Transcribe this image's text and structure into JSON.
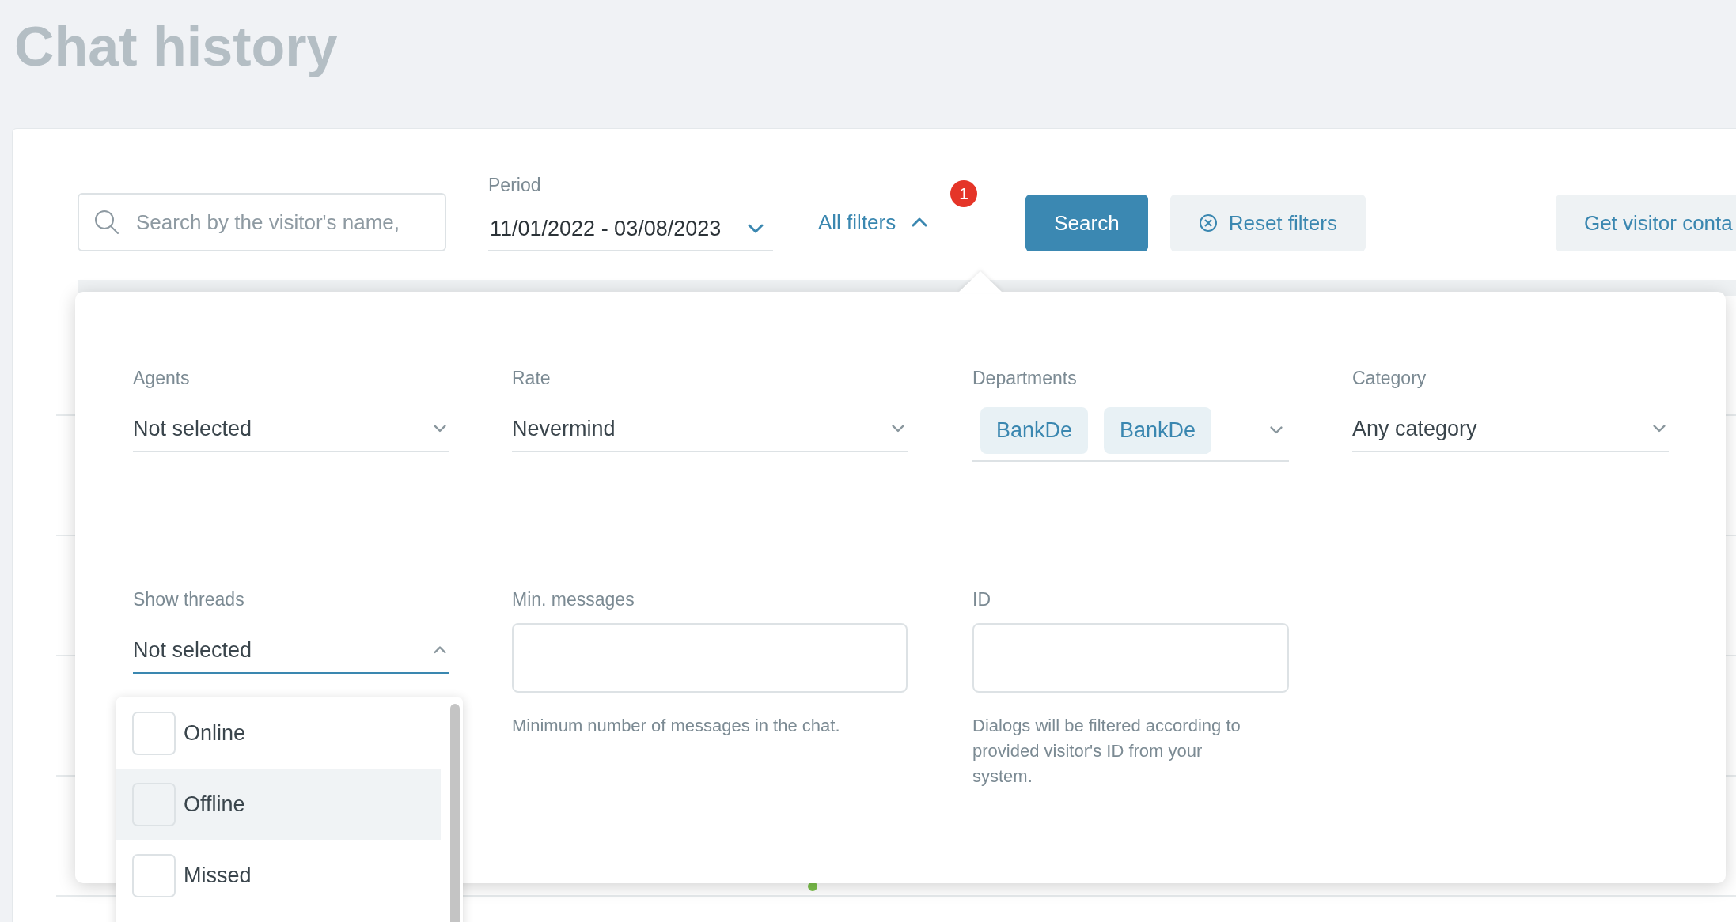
{
  "page_title": "Chat history",
  "toolbar": {
    "search": {
      "placeholder": "Search by the visitor's name,"
    },
    "period": {
      "label": "Period",
      "value": "11/01/2022 - 03/08/2023"
    },
    "all_filters": {
      "label": "All filters",
      "expanded": true,
      "badge": "1"
    },
    "buttons": [
      {
        "label": "Search",
        "kind": "primary"
      },
      {
        "label": "Reset filters",
        "kind": "reset"
      },
      {
        "label": "Get visitor conta",
        "kind": "secondary"
      }
    ]
  },
  "filters": [
    {
      "kind": "select",
      "label": "Agents",
      "value": "Not selected",
      "expanded": false
    },
    {
      "kind": "select",
      "label": "Rate",
      "value": "Nevermind",
      "expanded": false
    },
    {
      "kind": "tags",
      "label": "Departments",
      "tags": [
        "BankDe",
        "BankDe"
      ]
    },
    {
      "kind": "select",
      "label": "Category",
      "value": "Any category",
      "expanded": false
    },
    {
      "kind": "select",
      "label": "Show threads",
      "value": "Not selected",
      "expanded": true,
      "options": [
        {
          "label": "Online",
          "checked": false,
          "highlighted": false
        },
        {
          "label": "Offline",
          "checked": false,
          "highlighted": true
        },
        {
          "label": "Missed",
          "checked": false,
          "highlighted": false
        }
      ]
    },
    {
      "kind": "input",
      "label": "Min. messages",
      "help": "Minimum number of messages in the chat."
    },
    {
      "kind": "input",
      "label": "ID",
      "help": "Dialogs will be filtered according to provided visitor's ID from your system."
    }
  ]
}
